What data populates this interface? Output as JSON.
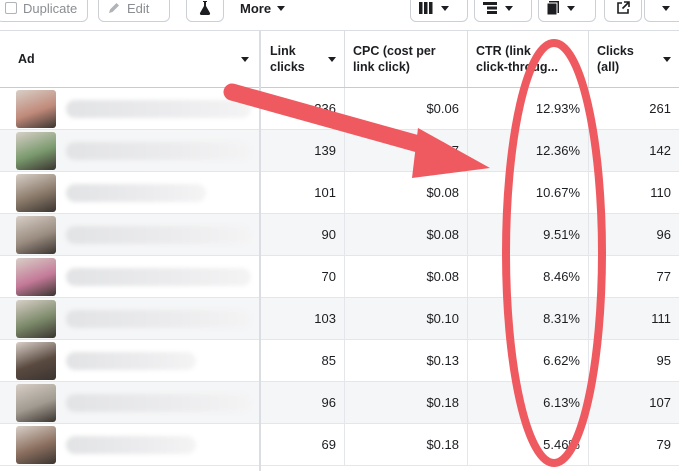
{
  "toolbar": {
    "duplicate_label": "Duplicate",
    "edit_label": "Edit",
    "more_label": "More"
  },
  "columns": {
    "ad": "Ad",
    "link_clicks": [
      "Link",
      "clicks"
    ],
    "cpc": [
      "CPC (cost per",
      "link click)"
    ],
    "ctr": [
      "CTR (link",
      "click-throug..."
    ],
    "clicks_all": [
      "Clicks",
      "(all)"
    ]
  },
  "rows": [
    {
      "link_clicks": "236",
      "cpc": "$0.06",
      "ctr": "12.93%",
      "clicks_all": "261",
      "thumb": "#c08a7a"
    },
    {
      "link_clicks": "139",
      "cpc": "$0.07",
      "ctr": "12.36%",
      "clicks_all": "142",
      "thumb": "#7a9a6e"
    },
    {
      "link_clicks": "101",
      "cpc": "$0.08",
      "ctr": "10.67%",
      "clicks_all": "110",
      "thumb": "#8a7a6a"
    },
    {
      "link_clicks": "90",
      "cpc": "$0.08",
      "ctr": "9.51%",
      "clicks_all": "96",
      "thumb": "#9a8c80"
    },
    {
      "link_clicks": "70",
      "cpc": "$0.08",
      "ctr": "8.46%",
      "clicks_all": "77",
      "thumb": "#c47a98"
    },
    {
      "link_clicks": "103",
      "cpc": "$0.10",
      "ctr": "8.31%",
      "clicks_all": "111",
      "thumb": "#7c8a6a"
    },
    {
      "link_clicks": "85",
      "cpc": "$0.13",
      "ctr": "6.62%",
      "clicks_all": "95",
      "thumb": "#5a4a40"
    },
    {
      "link_clicks": "96",
      "cpc": "$0.18",
      "ctr": "6.13%",
      "clicks_all": "107",
      "thumb": "#a09a90"
    },
    {
      "link_clicks": "69",
      "cpc": "$0.18",
      "ctr": "5.46%",
      "clicks_all": "79",
      "thumb": "#8c7060"
    }
  ],
  "annotation": {
    "arrow_color": "#ee5a5f",
    "ellipse_color": "#ee5a5f"
  }
}
